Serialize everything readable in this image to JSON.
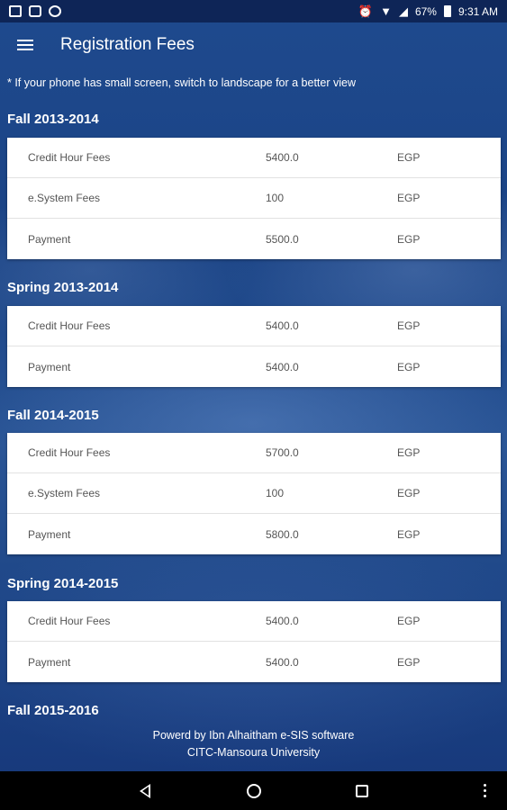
{
  "status_bar": {
    "battery": "67%",
    "time": "9:31 AM"
  },
  "app_bar": {
    "title": "Registration Fees"
  },
  "hint": "* If your phone has small screen, switch to landscape for a better view",
  "sections": [
    {
      "title": "Fall 2013-2014",
      "rows": [
        {
          "label": "Credit Hour Fees",
          "amount": "5400.0",
          "currency": "EGP"
        },
        {
          "label": "e.System Fees",
          "amount": "100",
          "currency": "EGP"
        },
        {
          "label": "Payment",
          "amount": "5500.0",
          "currency": "EGP"
        }
      ]
    },
    {
      "title": "Spring 2013-2014",
      "rows": [
        {
          "label": "Credit Hour Fees",
          "amount": "5400.0",
          "currency": "EGP"
        },
        {
          "label": "Payment",
          "amount": "5400.0",
          "currency": "EGP"
        }
      ]
    },
    {
      "title": "Fall 2014-2015",
      "rows": [
        {
          "label": "Credit Hour Fees",
          "amount": "5700.0",
          "currency": "EGP"
        },
        {
          "label": "e.System Fees",
          "amount": "100",
          "currency": "EGP"
        },
        {
          "label": "Payment",
          "amount": "5800.0",
          "currency": "EGP"
        }
      ]
    },
    {
      "title": "Spring 2014-2015",
      "rows": [
        {
          "label": "Credit Hour Fees",
          "amount": "5400.0",
          "currency": "EGP"
        },
        {
          "label": "Payment",
          "amount": "5400.0",
          "currency": "EGP"
        }
      ]
    },
    {
      "title": "Fall 2015-2016",
      "rows": []
    }
  ],
  "footer": {
    "line1": "Powerd by Ibn Alhaitham e-SIS software",
    "line2": "CITC-Mansoura University"
  }
}
